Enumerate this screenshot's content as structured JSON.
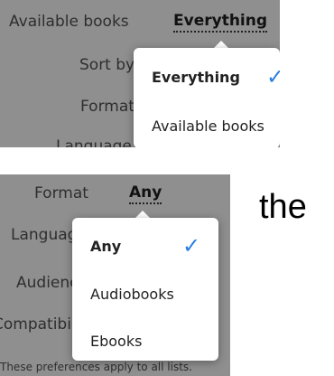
{
  "top_panel": {
    "filter_label": "Available books",
    "filter_value": "Everything",
    "sort_label": "Sort by",
    "format_label": "Format",
    "language_label": "Language",
    "dropdown": {
      "options": [
        "Everything",
        "Available books"
      ],
      "selected": "Everything"
    }
  },
  "bottom_panel": {
    "format_label": "Format",
    "format_value": "Any",
    "language_label": "Language",
    "audience_label": "Audience",
    "compatibility_label": "Compatibility",
    "dropdown": {
      "options": [
        "Any",
        "Audiobooks",
        "Ebooks"
      ],
      "selected": "Any"
    },
    "footer_note": "These preferences apply to all lists."
  },
  "side_text": "the",
  "colors": {
    "panel_bg": "#8f8f8f",
    "checkmark": "#2a7fe0",
    "dropdown_bg": "#ffffff"
  },
  "icons": {
    "selected_mark": "check-icon"
  }
}
